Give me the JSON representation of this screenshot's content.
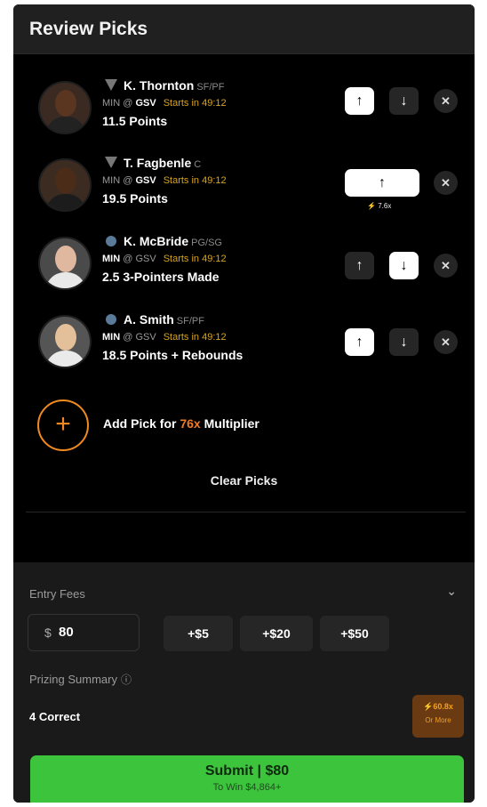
{
  "header": {
    "title": "Review Picks"
  },
  "picks": [
    {
      "name": "K. Thornton",
      "position": "SF/PF",
      "matchup_team": "MIN",
      "matchup_sep": "@",
      "matchup_opp": "GSV",
      "starts": "Starts in 49:12",
      "line": "11.5 Points",
      "selected": "up",
      "multiplier": ""
    },
    {
      "name": "T. Fagbenle",
      "position": "C",
      "matchup_team": "MIN",
      "matchup_sep": "@",
      "matchup_opp": "GSV",
      "starts": "Starts in 49:12",
      "line": "19.5 Points",
      "selected": "up",
      "multiplier": "7.6x"
    },
    {
      "name": "K. McBride",
      "position": "PG/SG",
      "matchup_team": "MIN",
      "matchup_sep": "@",
      "matchup_opp": "GSV",
      "starts": "Starts in 49:12",
      "line": "2.5 3-Pointers Made",
      "selected": "down",
      "multiplier": ""
    },
    {
      "name": "A. Smith",
      "position": "SF/PF",
      "matchup_team": "MIN",
      "matchup_sep": "@",
      "matchup_opp": "GSV",
      "starts": "Starts in 49:12",
      "line": "18.5 Points + Rebounds",
      "selected": "up",
      "multiplier": ""
    }
  ],
  "icons": {
    "up": "↑",
    "down": "↓",
    "remove": "✕",
    "add": "+",
    "chevron": "⌄",
    "info": "ⓘ",
    "bolt": "⚡"
  },
  "add_pick": {
    "prefix": "Add Pick for ",
    "accent": "76x",
    "suffix": " Multiplier"
  },
  "clear_picks": "Clear Picks",
  "entry": {
    "label": "Entry Fees",
    "currency": "$",
    "amount": "80",
    "quick": [
      "+$5",
      "+$20",
      "+$50"
    ]
  },
  "prizing": {
    "label": "Prizing Summary",
    "correct": "4 Correct",
    "badge_mult": "⚡60.8x",
    "badge_more": "Or More"
  },
  "submit": {
    "label": "Submit | $80",
    "to_win": "To Win $4,864+"
  },
  "colors": {
    "accent_orange": "#f08a20",
    "starts_yellow": "#d9a417",
    "submit_green": "#3dc43d"
  }
}
